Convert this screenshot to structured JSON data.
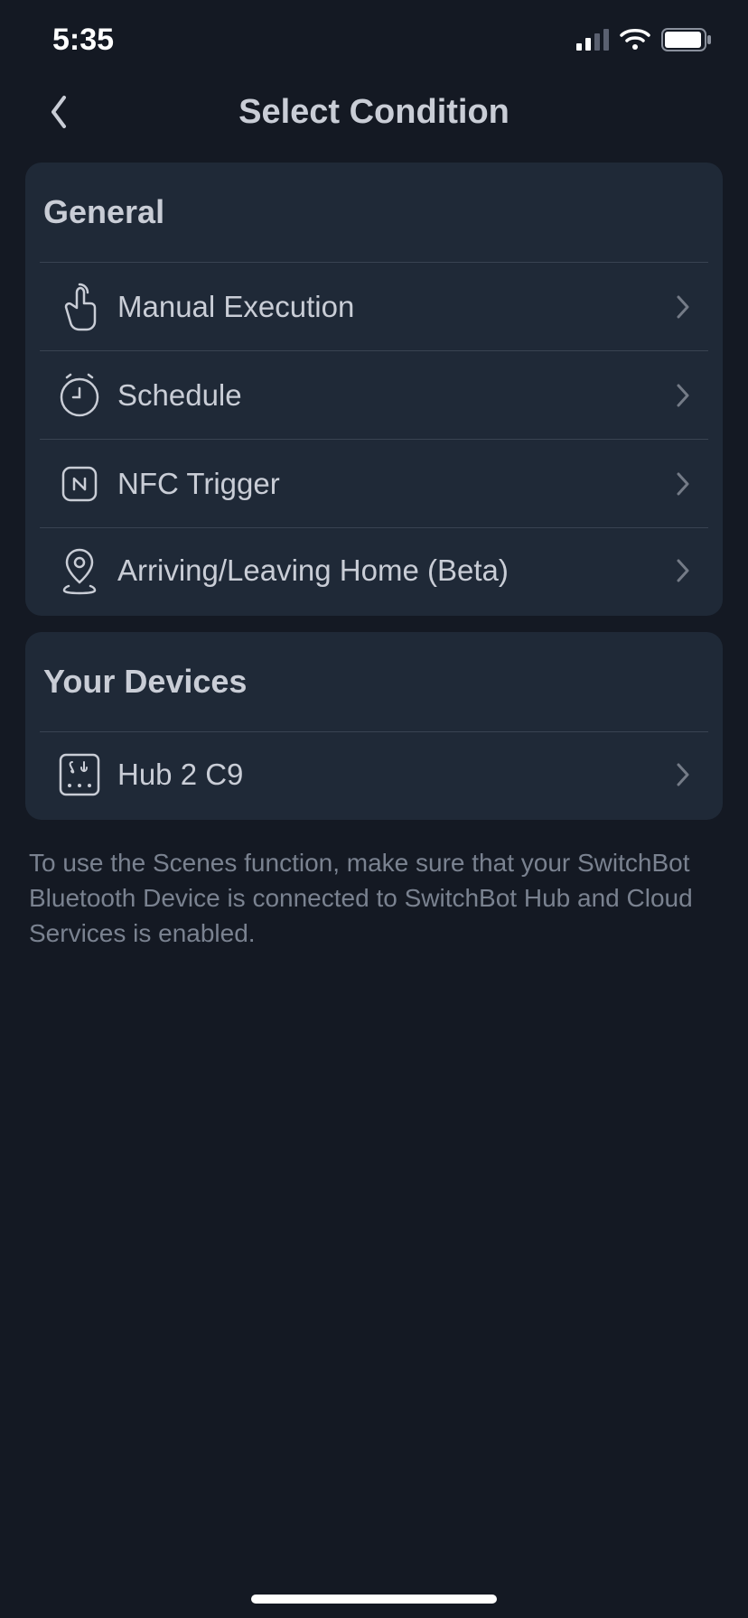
{
  "status": {
    "time": "5:35"
  },
  "nav": {
    "title": "Select Condition"
  },
  "sections": {
    "general": {
      "header": "General",
      "items": [
        {
          "label": "Manual Execution"
        },
        {
          "label": "Schedule"
        },
        {
          "label": "NFC Trigger"
        },
        {
          "label": "Arriving/Leaving Home (Beta)"
        }
      ]
    },
    "devices": {
      "header": "Your Devices",
      "items": [
        {
          "label": "Hub 2 C9"
        }
      ]
    }
  },
  "footer": {
    "text": "To use the Scenes function, make sure that your SwitchBot Bluetooth Device is connected to SwitchBot Hub and Cloud Services is enabled."
  }
}
